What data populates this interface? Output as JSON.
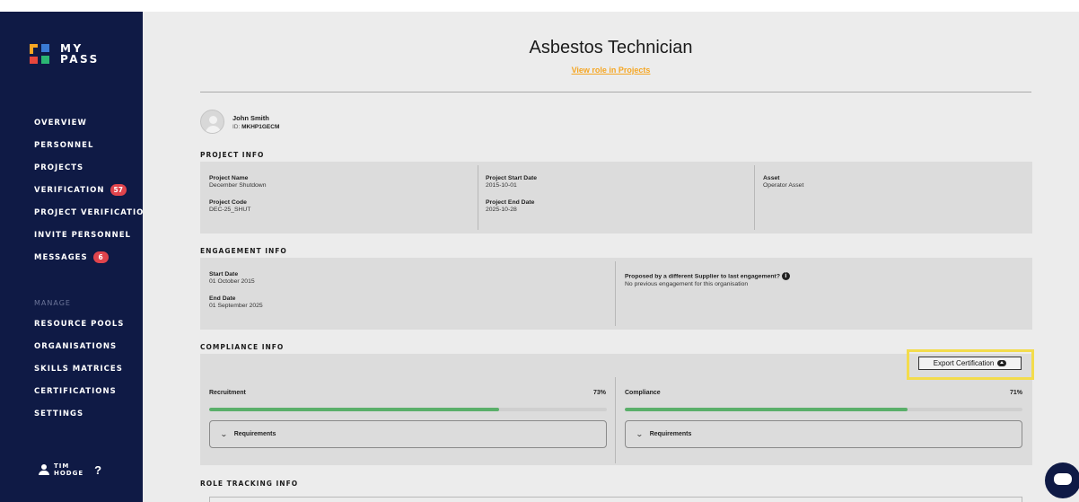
{
  "brand": {
    "name_line1": "MY",
    "name_line2": "PASS",
    "colors": {
      "sidebar": "#0f1a45",
      "accent": "#f5a623",
      "badge": "#e0444c",
      "progress": "#5aaf6a",
      "highlight": "#f3dc4c"
    }
  },
  "sidebar": {
    "items": [
      {
        "label": "OVERVIEW"
      },
      {
        "label": "PERSONNEL"
      },
      {
        "label": "PROJECTS"
      },
      {
        "label": "VERIFICATION",
        "badge": "57"
      },
      {
        "label": "PROJECT VERIFICATION"
      },
      {
        "label": "INVITE PERSONNEL"
      },
      {
        "label": "MESSAGES",
        "badge": "6"
      }
    ],
    "section_label": "MANAGE",
    "manage_items": [
      {
        "label": "RESOURCE POOLS"
      },
      {
        "label": "ORGANISATIONS"
      },
      {
        "label": "SKILLS MATRICES"
      },
      {
        "label": "CERTIFICATIONS"
      },
      {
        "label": "SETTINGS"
      }
    ],
    "user": {
      "first": "TIM",
      "last": "HODGE",
      "help": "?"
    }
  },
  "header": {
    "title": "Asbestos Technician",
    "link": "View role in Projects"
  },
  "person": {
    "name": "John Smith",
    "id_prefix": "ID: ",
    "id": "MKHP1GECM"
  },
  "project_info": {
    "title": "PROJECT INFO",
    "project_name_label": "Project Name",
    "project_name": "December Shutdown",
    "project_code_label": "Project Code",
    "project_code": "DEC-25_SHUT",
    "start_date_label": "Project Start Date",
    "start_date": "2015-10-01",
    "end_date_label": "Project End Date",
    "end_date": "2025-10-28",
    "asset_label": "Asset",
    "asset": "Operator Asset"
  },
  "engagement_info": {
    "title": "ENGAGEMENT INFO",
    "start_label": "Start Date",
    "start": "01 October 2015",
    "end_label": "End Date",
    "end": "01 September 2025",
    "proposed_label": "Proposed by a different Supplier to last engagement?",
    "proposed_value": "No previous engagement for this organisation"
  },
  "compliance_info": {
    "title": "COMPLIANCE INFO",
    "export_label": "Export Certification",
    "recruitment_label": "Recruitment",
    "recruitment_pct": "73%",
    "recruitment_value": 0.73,
    "compliance_label": "Compliance",
    "compliance_pct": "71%",
    "compliance_value": 0.71,
    "requirements_label": "Requirements"
  },
  "role_tracking": {
    "title": "ROLE TRACKING INFO"
  }
}
